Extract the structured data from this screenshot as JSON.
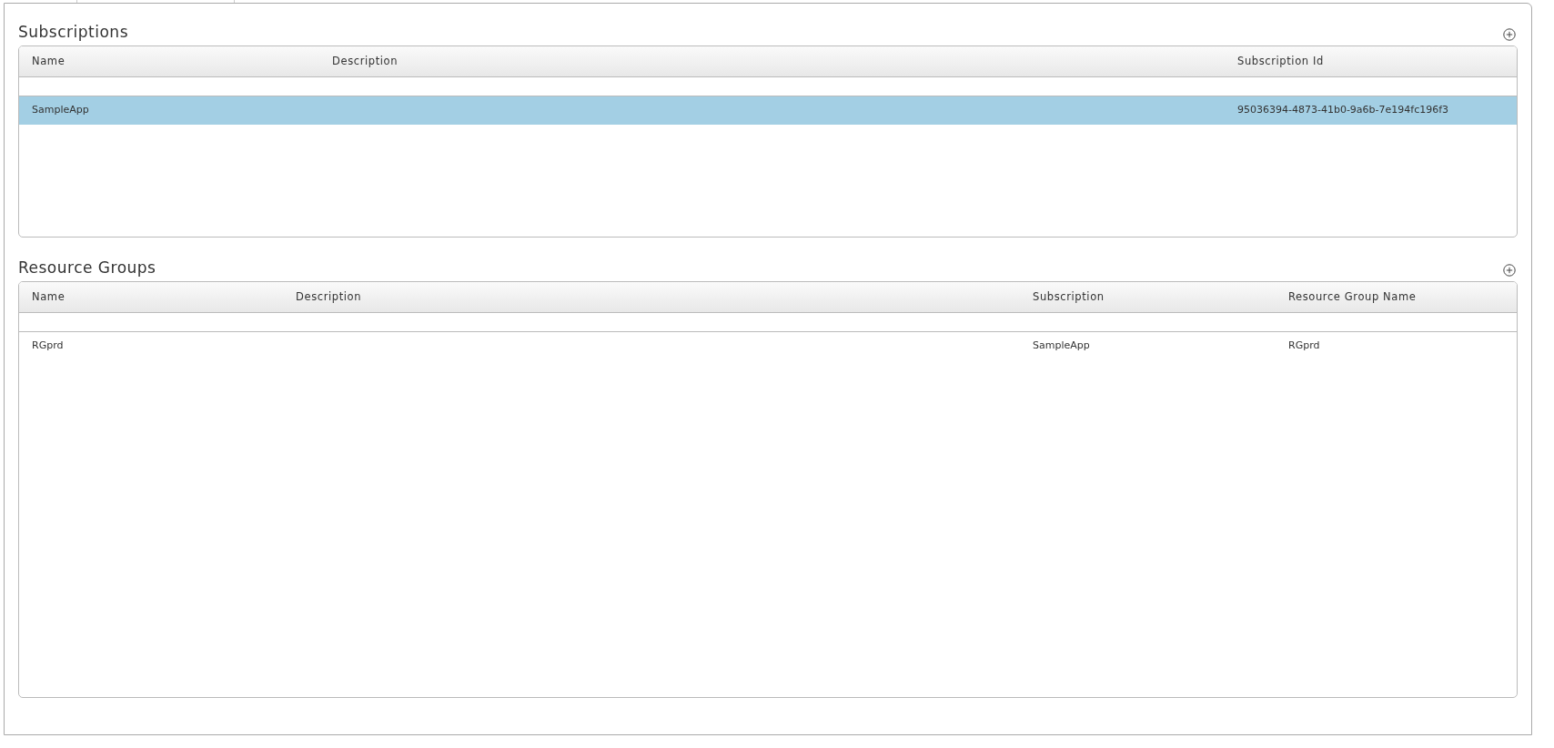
{
  "sections": [
    {
      "title": "Subscriptions",
      "columns": [
        "Name",
        "Description",
        "Subscription Id"
      ],
      "rows": [
        {
          "cells": [
            "SampleApp",
            "",
            "95036394-4873-41b0-9a6b-7e194fc196f3"
          ],
          "selected": true
        }
      ]
    },
    {
      "title": "Resource Groups",
      "columns": [
        "Name",
        "Description",
        "Subscription",
        "Resource Group Name"
      ],
      "rows": [
        {
          "cells": [
            "RGprd",
            "",
            "SampleApp",
            "RGprd"
          ],
          "selected": false
        }
      ]
    }
  ]
}
